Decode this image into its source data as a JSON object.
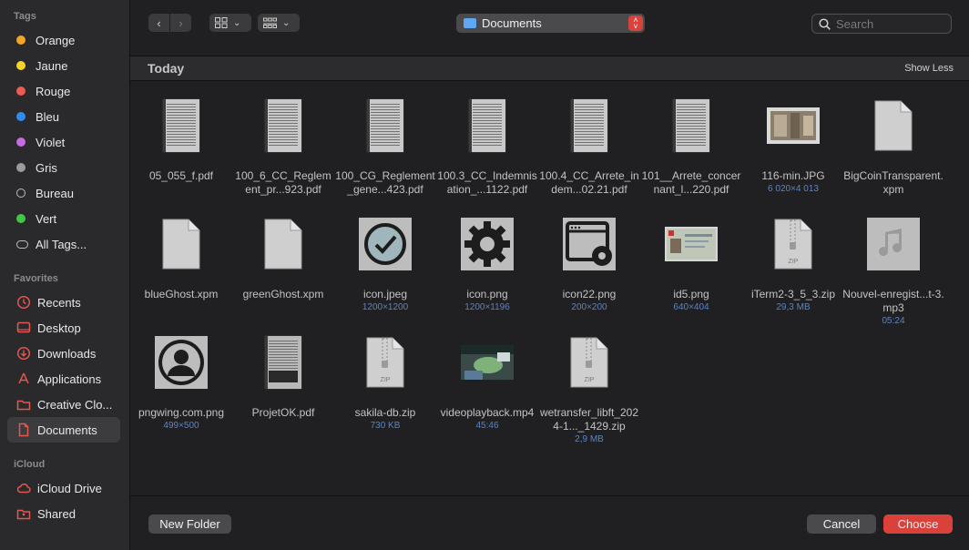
{
  "sidebar": {
    "tags_header": "Tags",
    "tags": [
      {
        "label": "Orange",
        "color": "#f5a623"
      },
      {
        "label": "Jaune",
        "color": "#f8d32b"
      },
      {
        "label": "Rouge",
        "color": "#ee5a55"
      },
      {
        "label": "Bleu",
        "color": "#2f8cf0"
      },
      {
        "label": "Violet",
        "color": "#c66be0"
      },
      {
        "label": "Gris",
        "color": "#9b9b9b"
      },
      {
        "label": "Bureau",
        "color": "hollow"
      },
      {
        "label": "Vert",
        "color": "#3fc745"
      },
      {
        "label": "All Tags...",
        "color": "alltags"
      }
    ],
    "favorites_header": "Favorites",
    "favorites": [
      {
        "label": "Recents",
        "icon": "clock-icon"
      },
      {
        "label": "Desktop",
        "icon": "desktop-icon"
      },
      {
        "label": "Downloads",
        "icon": "download-icon"
      },
      {
        "label": "Applications",
        "icon": "applications-icon"
      },
      {
        "label": "Creative Clo...",
        "icon": "folder-icon"
      },
      {
        "label": "Documents",
        "icon": "document-icon",
        "selected": true
      }
    ],
    "icloud_header": "iCloud",
    "icloud": [
      {
        "label": "iCloud Drive",
        "icon": "cloud-icon"
      },
      {
        "label": "Shared",
        "icon": "shared-folder-icon"
      }
    ]
  },
  "toolbar": {
    "location": "Documents",
    "search_placeholder": "Search"
  },
  "section": {
    "title": "Today",
    "toggle": "Show Less"
  },
  "files": [
    {
      "name": "05_055_f.pdf",
      "meta": "",
      "kind": "doc"
    },
    {
      "name": "100_6_CC_Reglement_pr...923.pdf",
      "meta": "",
      "kind": "doc"
    },
    {
      "name": "100_CG_Reglement_gene...423.pdf",
      "meta": "",
      "kind": "doc"
    },
    {
      "name": "100.3_CC_Indemnisation_...1122.pdf",
      "meta": "",
      "kind": "doc"
    },
    {
      "name": "100.4_CC_Arrete_indem...02.21.pdf",
      "meta": "",
      "kind": "doc"
    },
    {
      "name": "101__Arrete_concernant_l...220.pdf",
      "meta": "",
      "kind": "doc"
    },
    {
      "name": "116-min.JPG",
      "meta": "6 020×4 013",
      "kind": "photo"
    },
    {
      "name": "BigCoinTransparent.xpm",
      "meta": "",
      "kind": "blank"
    },
    {
      "name": "blueGhost.xpm",
      "meta": "",
      "kind": "blank"
    },
    {
      "name": "greenGhost.xpm",
      "meta": "",
      "kind": "blank"
    },
    {
      "name": "icon.jpeg",
      "meta": "1200×1200",
      "kind": "check"
    },
    {
      "name": "icon.png",
      "meta": "1200×1196",
      "kind": "gear"
    },
    {
      "name": "icon22.png",
      "meta": "200×200",
      "kind": "window-gear"
    },
    {
      "name": "id5.png",
      "meta": "640×404",
      "kind": "idcard"
    },
    {
      "name": "iTerm2-3_5_3.zip",
      "meta": "29,3 MB",
      "kind": "zip"
    },
    {
      "name": "Nouvel-enregist...t-3.mp3",
      "meta": "05:24",
      "kind": "audio"
    },
    {
      "name": "pngwing.com.png",
      "meta": "499×500",
      "kind": "avatar"
    },
    {
      "name": "ProjetOK.pdf",
      "meta": "",
      "kind": "docdark"
    },
    {
      "name": "sakila-db.zip",
      "meta": "730 KB",
      "kind": "zip"
    },
    {
      "name": "videoplayback.mp4",
      "meta": "45:46",
      "kind": "video"
    },
    {
      "name": "wetransfer_libft_2024-1..._1429.zip",
      "meta": "2,9 MB",
      "kind": "zip"
    }
  ],
  "zip_label": "ZIP",
  "buttons": {
    "new_folder": "New Folder",
    "cancel": "Cancel",
    "choose": "Choose"
  },
  "colors": {
    "accent": "#d9413a",
    "folder": "#5fa8ef",
    "meta_text": "#5b84c4"
  }
}
